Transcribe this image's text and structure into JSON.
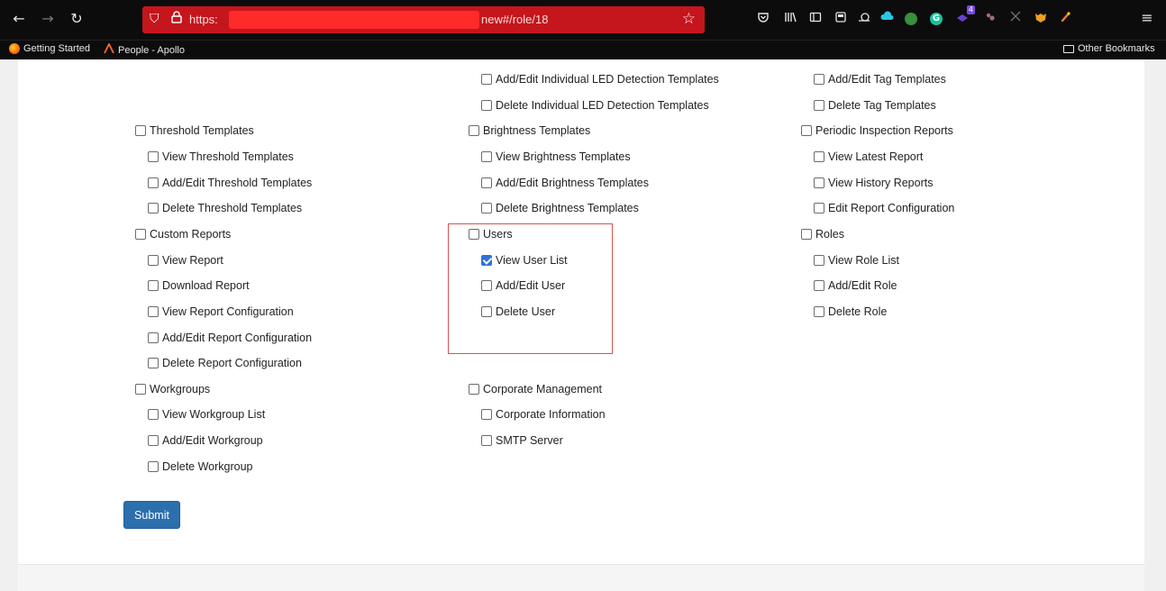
{
  "browser": {
    "url_scheme": "https:",
    "url_path": "new#/role/18",
    "bookmarks": [
      {
        "label": "Getting Started"
      },
      {
        "label": "People - Apollo"
      }
    ],
    "other_bookmarks": "Other Bookmarks",
    "extension_badge": "4",
    "icons": {
      "back": "←",
      "forward": "→",
      "reload": "↻",
      "shield": "⛉",
      "lock": "🔒",
      "star": "☆",
      "menu": "≡"
    }
  },
  "permissions": {
    "col1": [
      {
        "label": "Threshold Templates",
        "checked": false
      },
      {
        "label": "View Threshold Templates",
        "checked": false
      },
      {
        "label": "Add/Edit Threshold Templates",
        "checked": false
      },
      {
        "label": "Delete Threshold Templates",
        "checked": false
      },
      {
        "label": "Custom Reports",
        "checked": false
      },
      {
        "label": "View Report",
        "checked": false
      },
      {
        "label": "Download Report",
        "checked": false
      },
      {
        "label": "View Report Configuration",
        "checked": false
      },
      {
        "label": "Add/Edit Report Configuration",
        "checked": false
      },
      {
        "label": "Delete Report Configuration",
        "checked": false
      },
      {
        "label": "Workgroups",
        "checked": false
      },
      {
        "label": "View Workgroup List",
        "checked": false
      },
      {
        "label": "Add/Edit Workgroup",
        "checked": false
      },
      {
        "label": "Delete Workgroup",
        "checked": false
      }
    ],
    "col2": [
      {
        "label": "Add/Edit Individual LED Detection Templates",
        "checked": false
      },
      {
        "label": "Delete Individual LED Detection Templates",
        "checked": false
      },
      {
        "label": "Brightness Templates",
        "checked": false
      },
      {
        "label": "View Brightness Templates",
        "checked": false
      },
      {
        "label": "Add/Edit Brightness Templates",
        "checked": false
      },
      {
        "label": "Delete Brightness Templates",
        "checked": false
      },
      {
        "label": "Users",
        "checked": false
      },
      {
        "label": "View User List",
        "checked": true
      },
      {
        "label": "Add/Edit User",
        "checked": false
      },
      {
        "label": "Delete User",
        "checked": false
      },
      {
        "label": "Corporate Management",
        "checked": false
      },
      {
        "label": "Corporate Information",
        "checked": false
      },
      {
        "label": "SMTP Server",
        "checked": false
      }
    ],
    "col3": [
      {
        "label": "Add/Edit Tag Templates",
        "checked": false
      },
      {
        "label": "Delete Tag Templates",
        "checked": false
      },
      {
        "label": "Periodic Inspection Reports",
        "checked": false
      },
      {
        "label": "View Latest Report",
        "checked": false
      },
      {
        "label": "View History Reports",
        "checked": false
      },
      {
        "label": "Edit Report Configuration",
        "checked": false
      },
      {
        "label": "Roles",
        "checked": false
      },
      {
        "label": "View Role List",
        "checked": false
      },
      {
        "label": "Add/Edit Role",
        "checked": false
      },
      {
        "label": "Delete Role",
        "checked": false
      }
    ]
  },
  "submit_label": "Submit"
}
